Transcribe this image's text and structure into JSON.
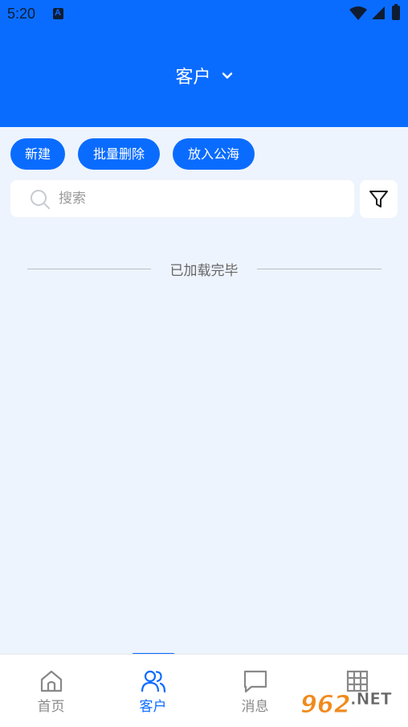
{
  "status_bar": {
    "time": "5:20"
  },
  "header": {
    "title": "客户"
  },
  "actions": [
    {
      "label": "新建"
    },
    {
      "label": "批量删除"
    },
    {
      "label": "放入公海"
    }
  ],
  "search": {
    "placeholder": "搜索"
  },
  "list": {
    "end_text": "已加载完毕"
  },
  "tabs": [
    {
      "label": "首页",
      "icon": "home-icon"
    },
    {
      "label": "客户",
      "icon": "users-icon",
      "active": true
    },
    {
      "label": "消息",
      "icon": "message-icon"
    },
    {
      "label": "",
      "icon": "grid-icon"
    }
  ],
  "colors": {
    "accent": "#0a6cff",
    "background": "#eef4fd",
    "inactive": "#888888"
  }
}
